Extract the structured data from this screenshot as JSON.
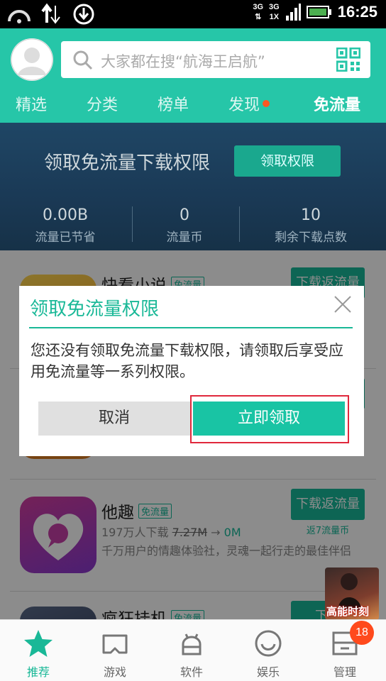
{
  "status_bar": {
    "time": "16:25",
    "net_3g_a": "3G",
    "net_3g_b": "3G",
    "net_1x": "1X"
  },
  "header": {
    "search_placeholder": "大家都在搜“航海王启航”",
    "tabs": [
      {
        "label": "精选"
      },
      {
        "label": "分类"
      },
      {
        "label": "榜单"
      },
      {
        "label": "发现"
      },
      {
        "label": "免流量"
      }
    ],
    "accent_color": "#26c6a8"
  },
  "banner": {
    "title": "领取免流量下载权限",
    "button_label": "领取权限",
    "stats": [
      {
        "value": "0.00B",
        "label": "流量已节省"
      },
      {
        "value": "0",
        "label": "流量币"
      },
      {
        "value": "10",
        "label": "剩余下载点数"
      }
    ]
  },
  "apps": [
    {
      "name": "快看小说",
      "badge": "免流量",
      "download_label": "下载返流量"
    },
    {
      "name": "他趣",
      "badge": "免流量",
      "downloads": "197万人下载",
      "original_size": "7.27M",
      "free_size": "0M",
      "description": "千万用户的情趣体验社，灵魂一起行走的最佳伴侣",
      "download_label": "下载返流量",
      "reward": "返7流量币"
    },
    {
      "name": "疯狂挂机",
      "badge": "免流量",
      "download_label": "下载"
    }
  ],
  "dialog": {
    "title": "领取免流量权限",
    "message": "您还没有领取免流量下载权限，请领取后享受应用免流量等一系列权限。",
    "cancel_label": "取消",
    "confirm_label": "立即领取"
  },
  "float_ad": {
    "text": "高能时刻"
  },
  "bottom_nav": {
    "items": [
      {
        "label": "推荐",
        "icon": "star-icon"
      },
      {
        "label": "游戏",
        "icon": "gamepad-icon"
      },
      {
        "label": "软件",
        "icon": "android-icon"
      },
      {
        "label": "娱乐",
        "icon": "smiley-icon"
      },
      {
        "label": "管理",
        "icon": "manage-icon"
      }
    ],
    "manage_badge": "18"
  }
}
